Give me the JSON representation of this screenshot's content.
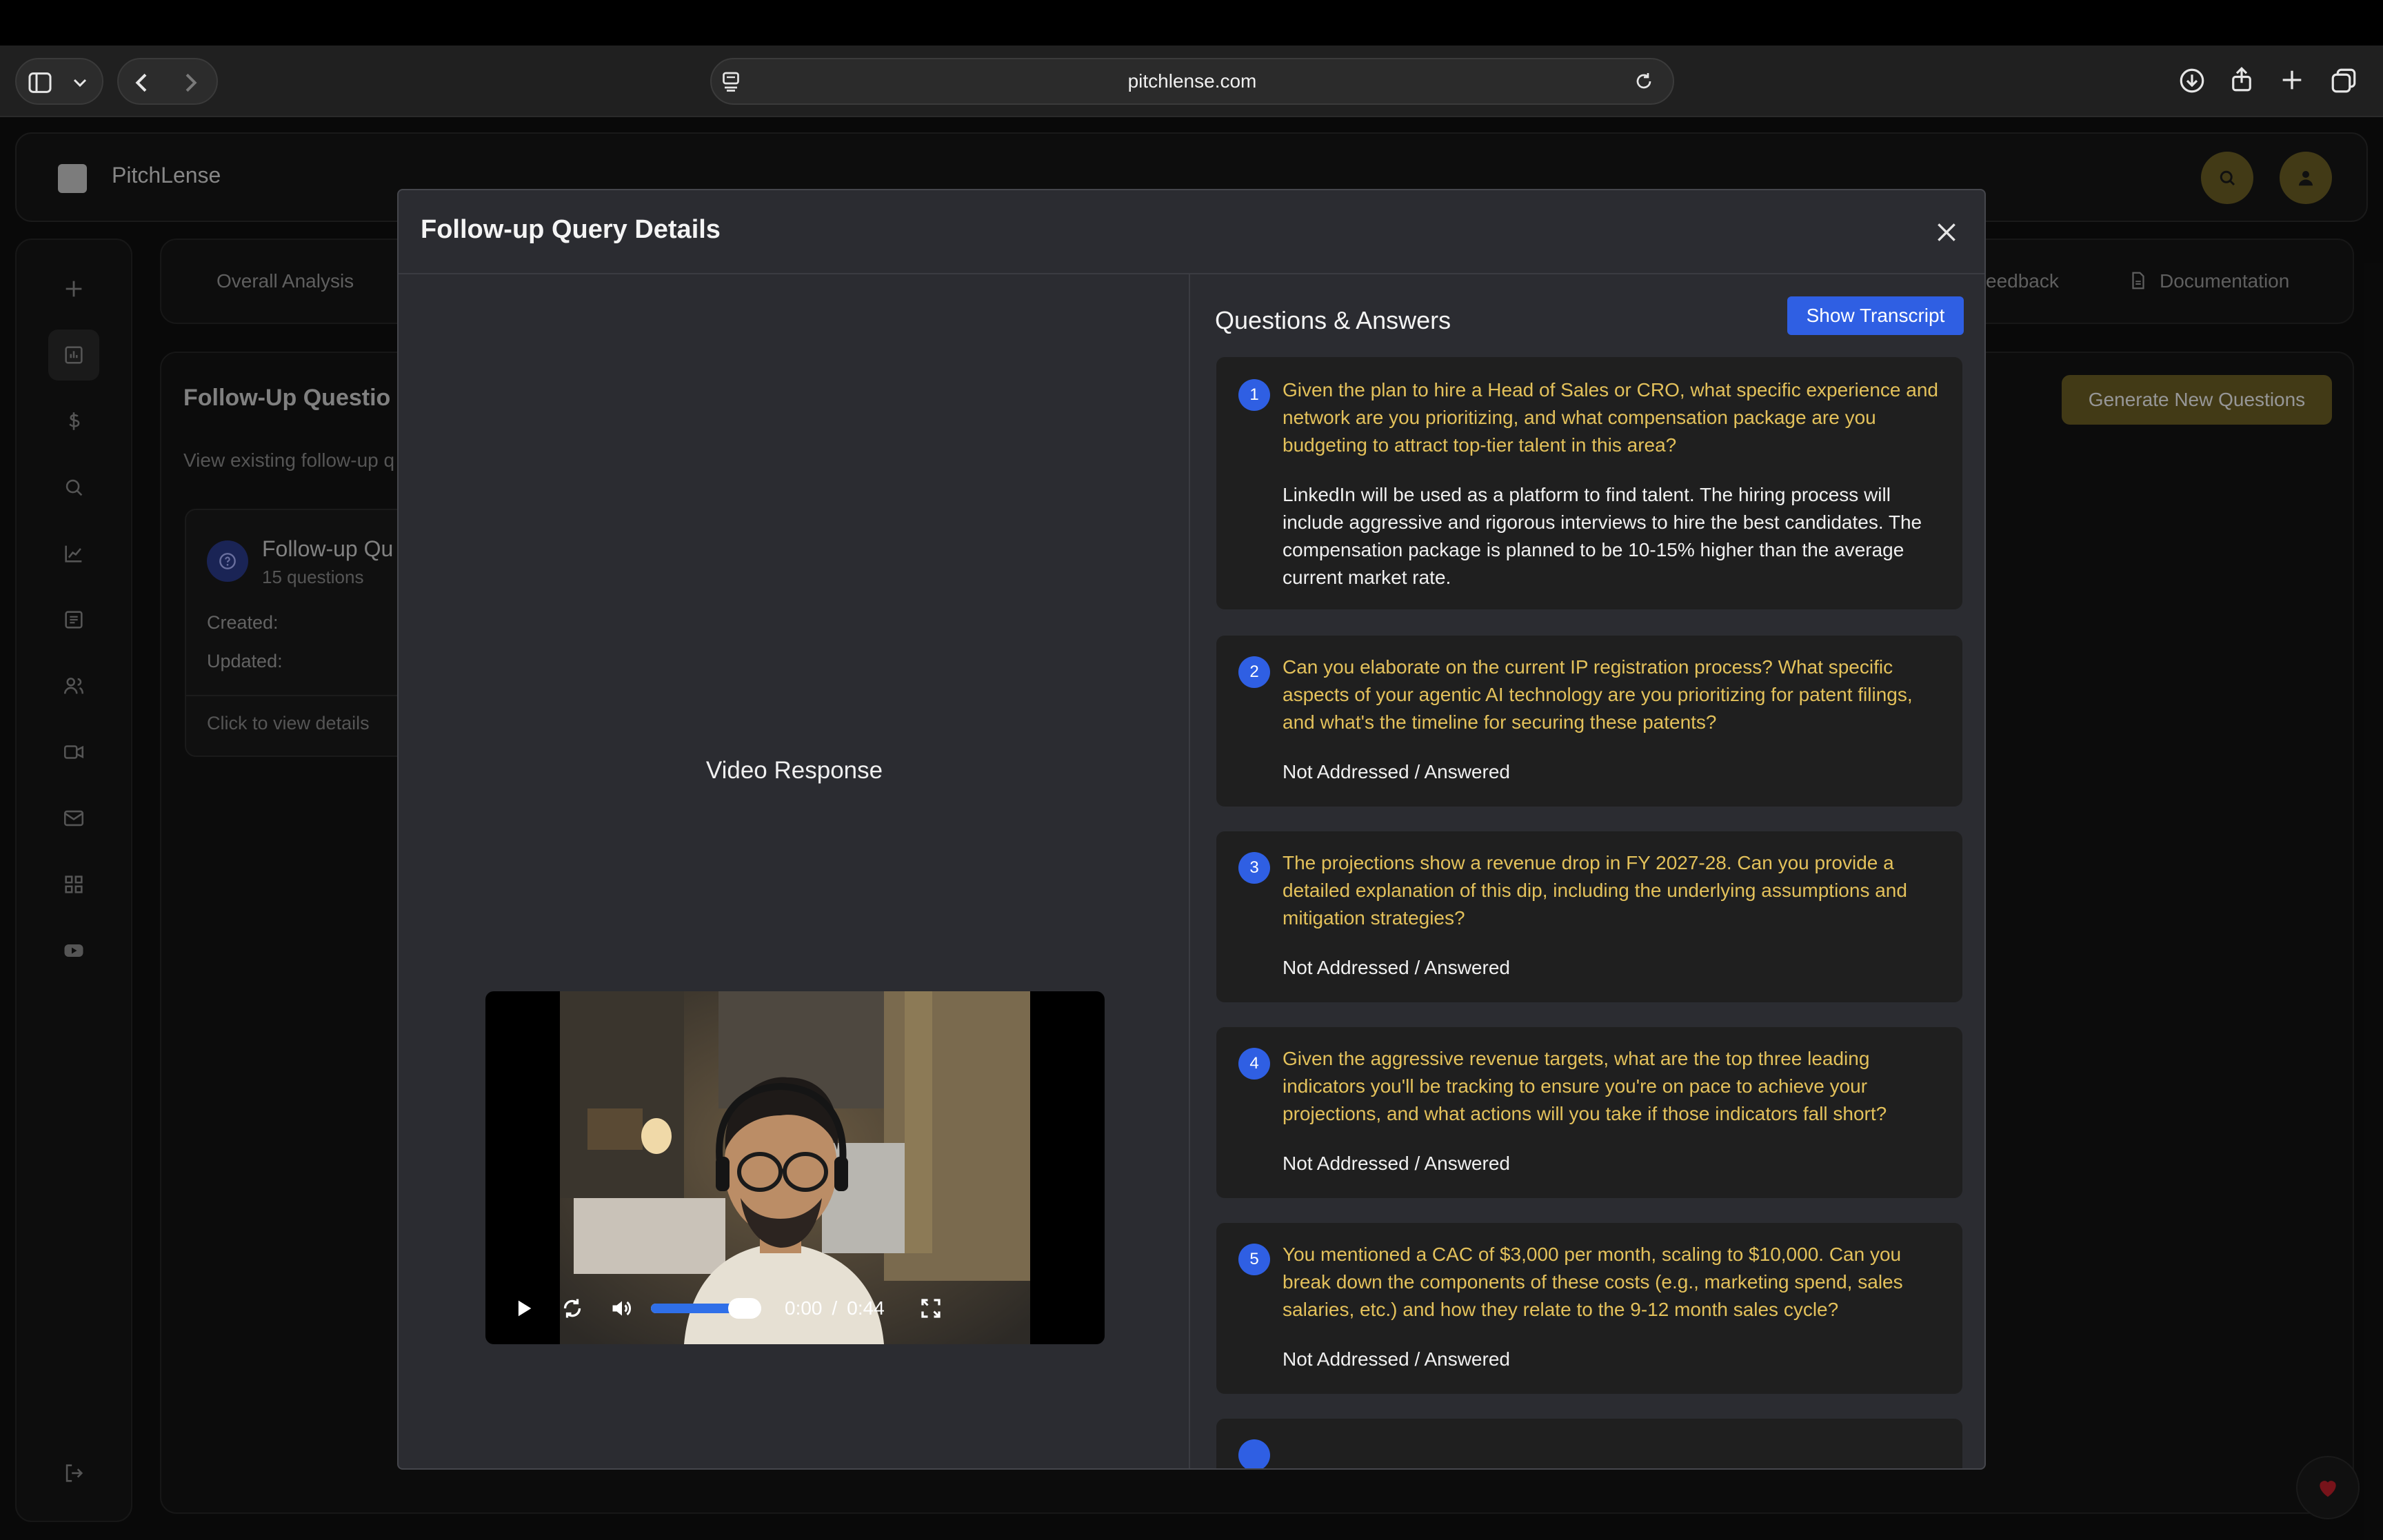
{
  "browser": {
    "url": "pitchlense.com"
  },
  "app": {
    "brand": "PitchLense",
    "tabs": {
      "overall": "Overall Analysis",
      "feedback": "eedback",
      "documentation": "Documentation"
    },
    "section_title": "Follow-Up Questio",
    "section_subtitle": "View existing follow-up q",
    "generate_button": "Generate New Questions",
    "card": {
      "title": "Follow-up Qu",
      "count": "15 questions",
      "created_label": "Created:",
      "updated_label": "Updated:",
      "hint": "Click to view details"
    }
  },
  "modal": {
    "title": "Follow-up Query Details",
    "video_label": "Video Response",
    "video": {
      "current_time": "0:00",
      "separator": "/",
      "duration": "0:44",
      "volume_level": 0.85
    },
    "qa_title": "Questions & Answers",
    "transcript_button": "Show Transcript",
    "items": [
      {
        "num": "1",
        "question": "Given the plan to hire a Head of Sales or CRO, what specific experience and network are you prioritizing, and what compensation package are you budgeting to attract top-tier talent in this area?",
        "answer": "LinkedIn will be used as a platform to find talent. The hiring process will include aggressive and rigorous interviews to hire the best candidates. The compensation package is planned to be 10-15% higher than the average current market rate."
      },
      {
        "num": "2",
        "question": "Can you elaborate on the current IP registration process? What specific aspects of your agentic AI technology are you prioritizing for patent filings, and what's the timeline for securing these patents?",
        "answer": "Not Addressed / Answered"
      },
      {
        "num": "3",
        "question": "The projections show a revenue drop in FY 2027-28. Can you provide a detailed explanation of this dip, including the underlying assumptions and mitigation strategies?",
        "answer": "Not Addressed / Answered"
      },
      {
        "num": "4",
        "question": "Given the aggressive revenue targets, what are the top three leading indicators you'll be tracking to ensure you're on pace to achieve your projections, and what actions will you take if those indicators fall short?",
        "answer": "Not Addressed / Answered"
      },
      {
        "num": "5",
        "question": "You mentioned a CAC of $3,000 per month, scaling to $10,000. Can you break down the components of these costs (e.g., marketing spend, sales salaries, etc.) and how they relate to the 9-12 month sales cycle?",
        "answer": "Not Addressed / Answered"
      }
    ]
  }
}
